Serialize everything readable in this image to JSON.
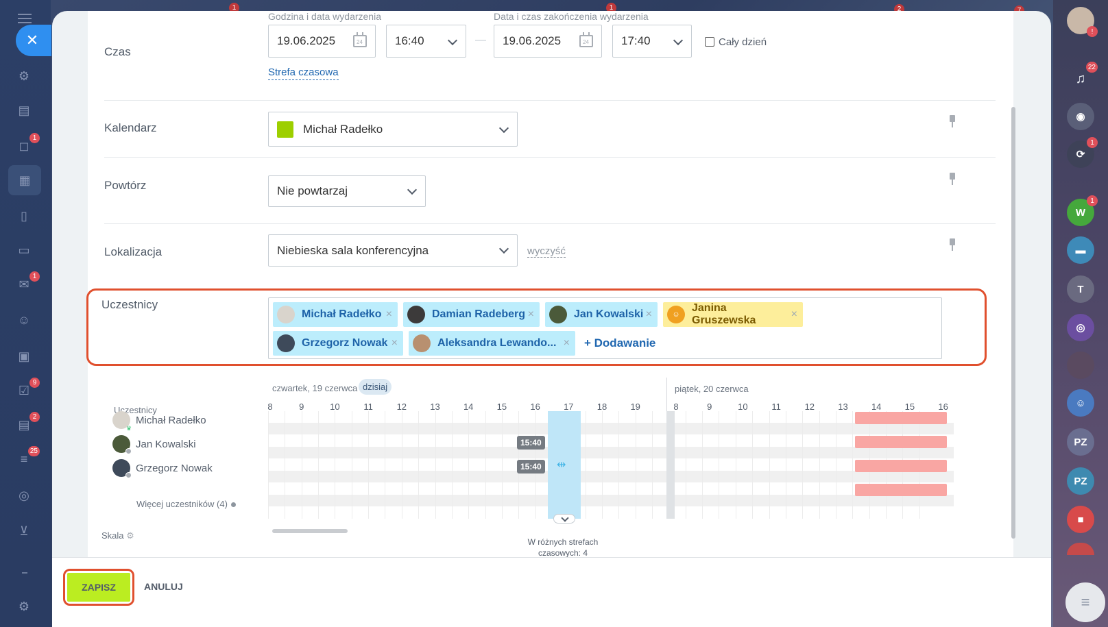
{
  "time_section": {
    "label": "Czas",
    "start_caption": "Godzina i data wydarzenia",
    "end_caption": "Data i czas zakończenia wydarzenia",
    "start_date": "19.06.2025",
    "start_time": "16:40",
    "end_date": "19.06.2025",
    "end_time": "17:40",
    "date_separator": "—",
    "all_day_label": "Cały dzień",
    "calendar_icon_text": "24",
    "timezone_link": "Strefa czasowa"
  },
  "calendar_section": {
    "label": "Kalendarz",
    "value": "Michał Radełko",
    "color": "#9dcf00"
  },
  "repeat_section": {
    "label": "Powtórz",
    "value": "Nie powtarzaj"
  },
  "location_section": {
    "label": "Lokalizacja",
    "value": "Niebieska sala konferencyjna",
    "clear_link": "wyczyść"
  },
  "participants_section": {
    "label": "Uczestnicy",
    "tags": [
      {
        "name": "Michał Radełko"
      },
      {
        "name": "Damian Radeberg"
      },
      {
        "name": "Jan Kowalski"
      },
      {
        "name": "Janina Gruszewska",
        "style": "yellow"
      },
      {
        "name": "Grzegorz Nowak"
      },
      {
        "name": "Aleksandra Lewando..."
      }
    ],
    "remove_symbol": "×",
    "add_label": "+ Dodawanie"
  },
  "planner": {
    "day1_label": "czwartek, 19 czerwca",
    "today_label": "dzisiaj",
    "day2_label": "piątek, 20 czerwca",
    "participants_header": "Uczestnicy",
    "hours_day1": [
      "8",
      "9",
      "10",
      "11",
      "12",
      "13",
      "14",
      "15",
      "16",
      "17",
      "18",
      "19"
    ],
    "hours_day2": [
      "8",
      "9",
      "10",
      "11",
      "12",
      "13",
      "14",
      "15",
      "16"
    ],
    "people": [
      {
        "name": "Michał Radełko"
      },
      {
        "name": "Jan Kowalski"
      },
      {
        "name": "Grzegorz Nowak"
      }
    ],
    "more_participants": "Więcej uczestników (4)",
    "time_chip": "15:40",
    "scale_label": "Skala",
    "timezone_note_line1": "W różnych strefach",
    "timezone_note_line2": "czasowych: 4",
    "busy_color": "#f9a6a3",
    "selection_color": "#bfe6f8"
  },
  "footer": {
    "save_label": "ZAPISZ",
    "cancel_label": "ANULUJ"
  },
  "left_sidebar": {
    "close_symbol": "✕",
    "badges": {
      "chat": "1",
      "mail": "1",
      "tasks": "9",
      "contacts": "2",
      "feed": "25"
    }
  },
  "top_badges": [
    "1",
    "1",
    "2",
    "7"
  ],
  "right_sidebar": {
    "notifications_badge": "22",
    "avatar_alert": "!",
    "sync_badge": "1",
    "w_badge": "1",
    "w_label": "W",
    "pz1_label": "PZ",
    "pz2_label": "PZ"
  },
  "colors": {
    "accent_blue": "#2067b0",
    "save_green": "#bbed21",
    "highlight_red": "#e0502e",
    "tag_blue": "#bcedfc",
    "tag_yellow": "#fdee9b"
  }
}
